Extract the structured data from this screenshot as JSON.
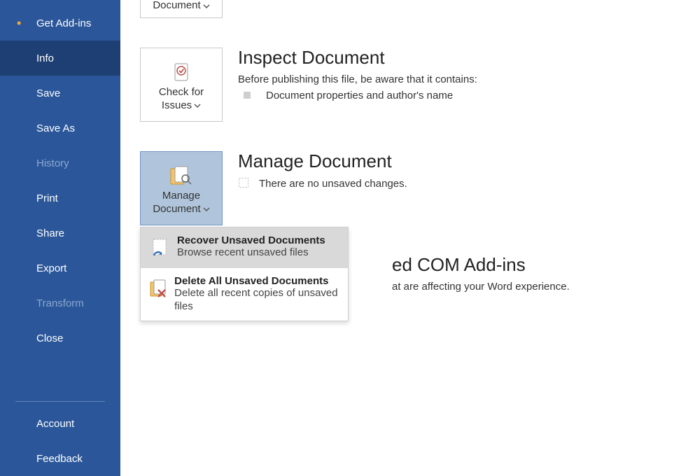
{
  "sidebar": {
    "items": [
      {
        "label": "Get Add-ins"
      },
      {
        "label": "Info"
      },
      {
        "label": "Save"
      },
      {
        "label": "Save As"
      },
      {
        "label": "History"
      },
      {
        "label": "Print"
      },
      {
        "label": "Share"
      },
      {
        "label": "Export"
      },
      {
        "label": "Transform"
      },
      {
        "label": "Close"
      }
    ],
    "account": "Account",
    "feedback": "Feedback"
  },
  "topPartial": {
    "line2": "Document"
  },
  "inspect": {
    "button_line1": "Check for",
    "button_line2": "Issues",
    "heading": "Inspect Document",
    "desc": "Before publishing this file, be aware that it contains:",
    "bullet1": "Document properties and author's name"
  },
  "manage": {
    "button_line1": "Manage",
    "button_line2": "Document",
    "heading": "Manage Document",
    "desc": "There are no unsaved changes."
  },
  "dropdown": {
    "item1": {
      "title": "Recover Unsaved Documents",
      "sub": "Browse recent unsaved files"
    },
    "item2": {
      "title": "Delete All Unsaved Documents",
      "sub": "Delete all recent copies of unsaved files"
    }
  },
  "addins": {
    "heading_fragment": "ed COM Add-ins",
    "desc_fragment": "at are affecting your Word experience."
  }
}
